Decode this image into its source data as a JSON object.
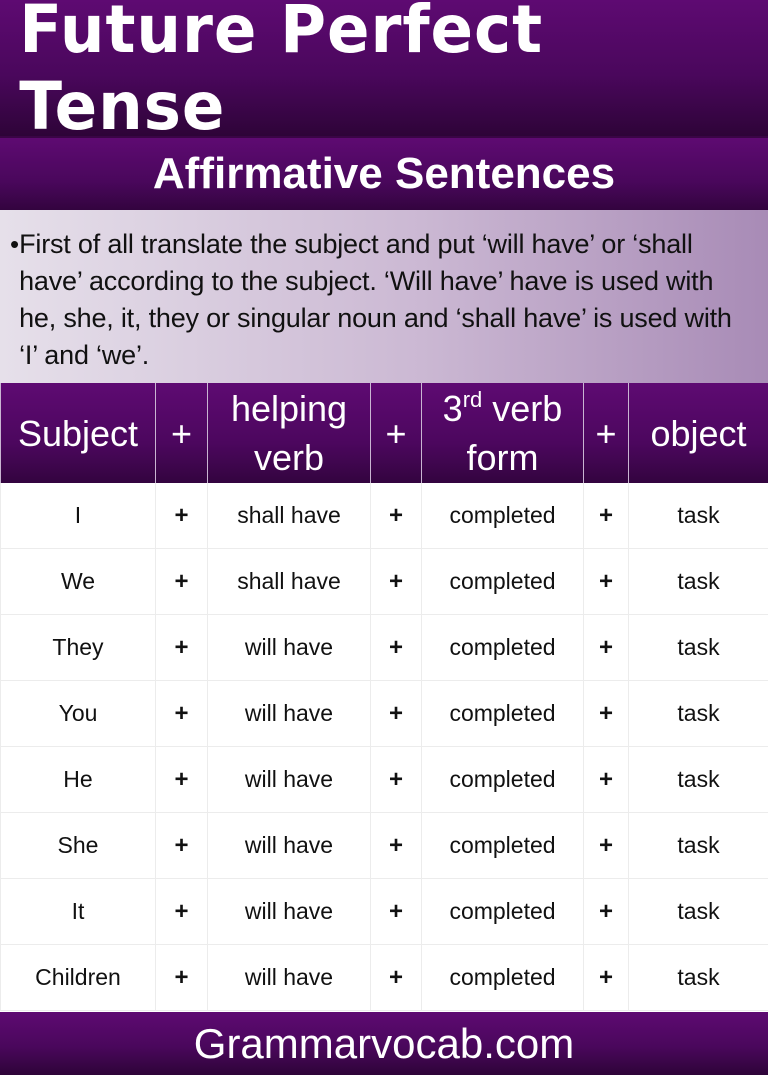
{
  "title": "Future Perfect Tense",
  "subtitle": "Affirmative Sentences",
  "description": {
    "bullet": "•",
    "text": "First of all translate the subject and put ‘will have’ or ‘shall have’ according to the subject. ‘Will have’ have is used with he, she, it, they or singular noun and ‘shall have’ is used with ‘I’ and ‘we’."
  },
  "table": {
    "headers": {
      "subject": "Subject",
      "plus": "+",
      "helping_line1": "helping",
      "helping_line2": "verb",
      "verb_num": "3",
      "verb_sup": "rd",
      "verb_line1_rest": " verb",
      "verb_line2": "form",
      "object": "object"
    },
    "rows": [
      {
        "subject": "I",
        "plus": "+",
        "helping": "shall have",
        "verb": "completed",
        "object": "task"
      },
      {
        "subject": "We",
        "plus": "+",
        "helping": "shall have",
        "verb": "completed",
        "object": "task"
      },
      {
        "subject": "They",
        "plus": "+",
        "helping": "will have",
        "verb": "completed",
        "object": "task"
      },
      {
        "subject": "You",
        "plus": "+",
        "helping": "will have",
        "verb": "completed",
        "object": "task"
      },
      {
        "subject": "He",
        "plus": "+",
        "helping": "will have",
        "verb": "completed",
        "object": "task"
      },
      {
        "subject": "She",
        "plus": "+",
        "helping": "will have",
        "verb": "completed",
        "object": "task"
      },
      {
        "subject": "It",
        "plus": "+",
        "helping": "will have",
        "verb": "completed",
        "object": "task"
      },
      {
        "subject": "Children",
        "plus": "+",
        "helping": "will have",
        "verb": "completed",
        "object": "task"
      }
    ]
  },
  "footer": "Grammarvocab.com",
  "colors": {
    "brand_purple": "#5e0a72",
    "dark_purple": "#2e0438"
  }
}
